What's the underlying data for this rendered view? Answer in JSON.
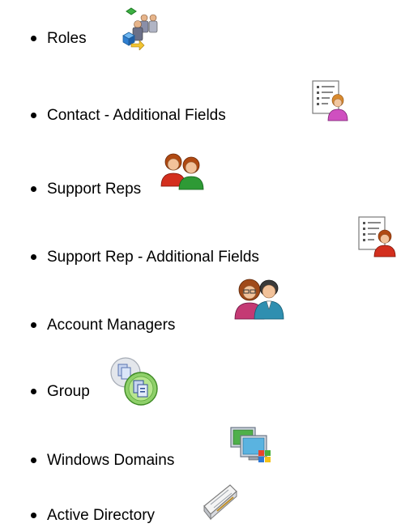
{
  "items": [
    {
      "label": "Roles",
      "icon": "roles-icon"
    },
    {
      "label": "Contact - Additional Fields",
      "icon": "contact-fields-icon"
    },
    {
      "label": "Support Reps",
      "icon": "support-reps-icon"
    },
    {
      "label": "Support Rep - Additional Fields",
      "icon": "support-rep-fields-icon"
    },
    {
      "label": "Account Managers",
      "icon": "account-managers-icon"
    },
    {
      "label": "Group",
      "icon": "group-icon"
    },
    {
      "label": "Windows Domains",
      "icon": "windows-domains-icon"
    },
    {
      "label": "Active Directory",
      "icon": "active-directory-icon"
    }
  ]
}
